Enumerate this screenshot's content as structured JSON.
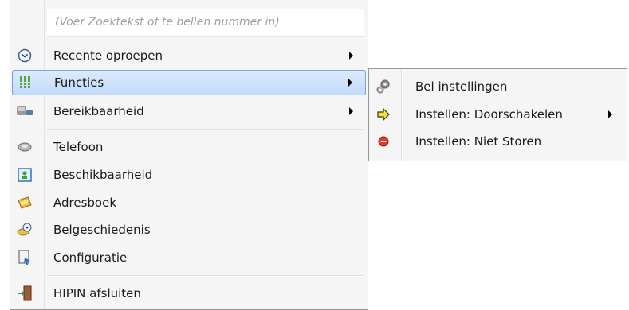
{
  "search": {
    "placeholder": "(Voer Zoektekst of te bellen nummer in)"
  },
  "main_menu": {
    "items": [
      {
        "label": "Recente oproepen",
        "icon": "clock-icon",
        "has_submenu": true
      },
      {
        "label": "Functies",
        "icon": "keypad-grid-icon",
        "has_submenu": true,
        "highlighted": true
      },
      {
        "label": "Bereikbaarheid",
        "icon": "phone-status-icon",
        "has_submenu": true
      },
      {
        "label": "Telefoon",
        "icon": "telephone-icon",
        "has_submenu": false
      },
      {
        "label": "Beschikbaarheid",
        "icon": "availability-card-icon",
        "has_submenu": false
      },
      {
        "label": "Adresboek",
        "icon": "address-book-icon",
        "has_submenu": false
      },
      {
        "label": "Belgeschiedenis",
        "icon": "call-history-icon",
        "has_submenu": false
      },
      {
        "label": "Configuratie",
        "icon": "configuration-icon",
        "has_submenu": false
      },
      {
        "label": "HIPIN afsluiten",
        "icon": "exit-door-icon",
        "has_submenu": false
      }
    ]
  },
  "sub_menu": {
    "items": [
      {
        "label": "Bel instellingen",
        "icon": "gears-icon",
        "has_submenu": false
      },
      {
        "label": "Instellen: Doorschakelen",
        "icon": "forward-arrow-icon",
        "has_submenu": true
      },
      {
        "label": "Instellen: Niet Storen",
        "icon": "do-not-disturb-icon",
        "has_submenu": false
      }
    ]
  },
  "colors": {
    "menu_background": "#f5f5f5",
    "highlight_border": "#7da2ce",
    "highlight_fill": "#c9e0fc"
  }
}
